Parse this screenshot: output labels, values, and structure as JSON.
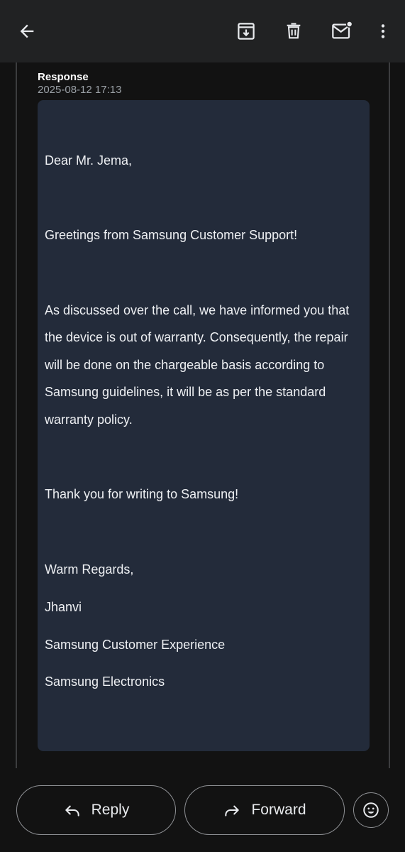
{
  "toolbar": {
    "back_icon": "arrow-back-icon",
    "archive_icon": "archive-icon",
    "delete_icon": "trash-icon",
    "mark_unread_icon": "mark-unread-icon",
    "more_icon": "more-vert-icon"
  },
  "message": {
    "sender": "Response",
    "timestamp": "2025-08-12 17:13",
    "body_lines": [
      "Dear Mr. Jema,",
      "Greetings from Samsung Customer Support!",
      "As discussed over the call, we have informed you that",
      "the device is out of warranty. Consequently, the repair",
      "will be done on the chargeable basis according to",
      "Samsung guidelines, it will be as per the standard",
      "warranty policy.",
      "Thank you for writing to Samsung!",
      "Warm Regards,",
      "Jhanvi",
      "Samsung Customer Experience",
      "Samsung Electronics"
    ]
  },
  "actions": {
    "reply_label": "Reply",
    "forward_label": "Forward",
    "reply_icon": "reply-icon",
    "forward_icon": "forward-icon",
    "emoji_icon": "emoji-reaction-icon"
  },
  "colors": {
    "topbar": "#212223",
    "background": "#121212",
    "card": "#232b3a",
    "text": "#e8eaed",
    "muted": "#9aa0a6"
  }
}
